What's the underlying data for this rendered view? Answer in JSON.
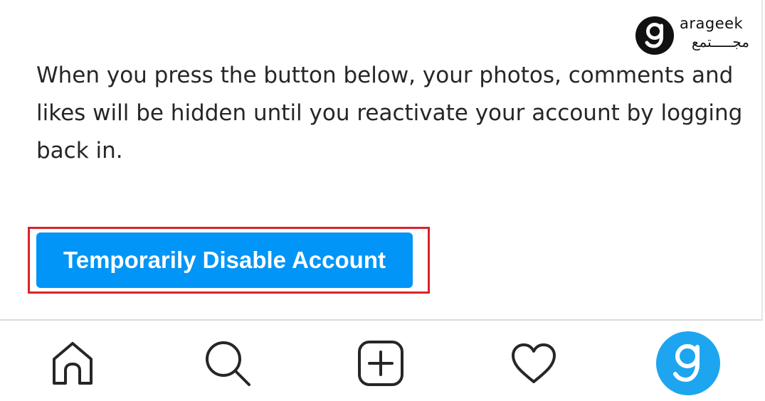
{
  "watermark": {
    "latin": "arageek",
    "arabic": "مجـــــتمع",
    "letter": "g"
  },
  "settings": {
    "description": "When you press the button below, your photos, comments and likes will be hidden until you reactivate your account by logging back in.",
    "disable_button_label": "Temporarily Disable Account",
    "accent_color": "#0095f6",
    "highlight_color": "#d8232a"
  },
  "bottom_nav": {
    "items": [
      {
        "name": "home",
        "icon": "home-icon"
      },
      {
        "name": "search",
        "icon": "search-icon"
      },
      {
        "name": "new-post",
        "icon": "plus-square-icon"
      },
      {
        "name": "activity",
        "icon": "heart-icon"
      },
      {
        "name": "profile",
        "icon": "avatar"
      }
    ]
  }
}
